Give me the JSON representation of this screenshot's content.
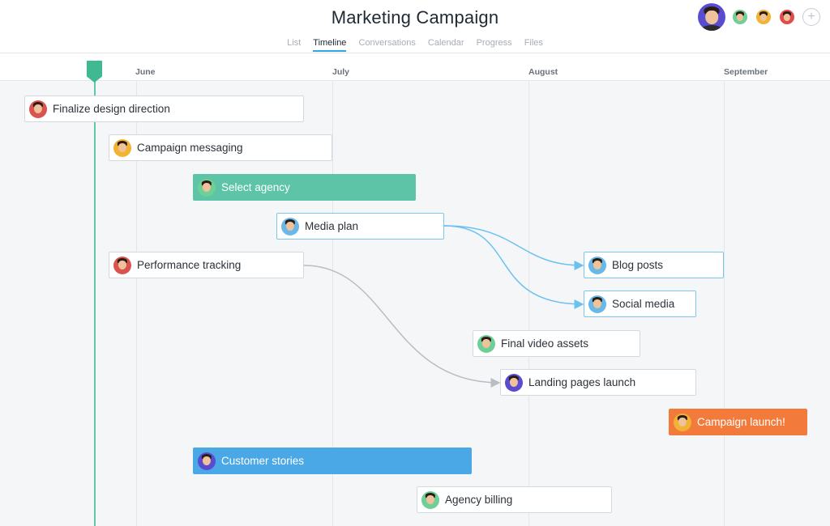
{
  "project": {
    "title": "Marketing Campaign"
  },
  "tabs": [
    {
      "label": "List"
    },
    {
      "label": "Timeline",
      "active": true
    },
    {
      "label": "Conversations"
    },
    {
      "label": "Calendar"
    },
    {
      "label": "Progress"
    },
    {
      "label": "Files"
    }
  ],
  "members": [
    {
      "icon": "user-avatar-icon",
      "color": "#5a4cd1"
    },
    {
      "icon": "user-avatar-icon",
      "color": "#6fcf97"
    },
    {
      "icon": "user-avatar-icon",
      "color": "#f2b233"
    },
    {
      "icon": "user-avatar-icon",
      "color": "#e24b4b"
    }
  ],
  "add_member_icon": "plus-icon",
  "months": [
    {
      "label": "June"
    },
    {
      "label": "July"
    },
    {
      "label": "August"
    },
    {
      "label": "September"
    }
  ],
  "tasks": [
    {
      "label": "Finalize design direction",
      "style": "white",
      "avatar_color": "#d9534f"
    },
    {
      "label": "Campaign messaging",
      "style": "white",
      "avatar_color": "#f2b233"
    },
    {
      "label": "Select agency",
      "style": "green",
      "avatar_color": "#6fcf97"
    },
    {
      "label": "Media plan",
      "style": "highlight",
      "avatar_color": "#69b8e8"
    },
    {
      "label": "Performance tracking",
      "style": "white",
      "avatar_color": "#d9534f"
    },
    {
      "label": "Blog posts",
      "style": "highlight",
      "avatar_color": "#69b8e8"
    },
    {
      "label": "Social media",
      "style": "highlight",
      "avatar_color": "#69b8e8"
    },
    {
      "label": "Final video assets",
      "style": "white",
      "avatar_color": "#6fcf97"
    },
    {
      "label": "Landing pages launch",
      "style": "white",
      "avatar_color": "#5a4cd1"
    },
    {
      "label": "Campaign launch!",
      "style": "orange",
      "avatar_color": "#f2b233"
    },
    {
      "label": "Customer stories",
      "style": "blue",
      "avatar_color": "#5a4cd1"
    },
    {
      "label": "Agency billing",
      "style": "white",
      "avatar_color": "#6fcf97"
    }
  ],
  "colors": {
    "accent": "#2da6e8",
    "today": "#3fb992",
    "dependency_active": "#6cc1f0",
    "dependency": "#b9bdc4"
  }
}
